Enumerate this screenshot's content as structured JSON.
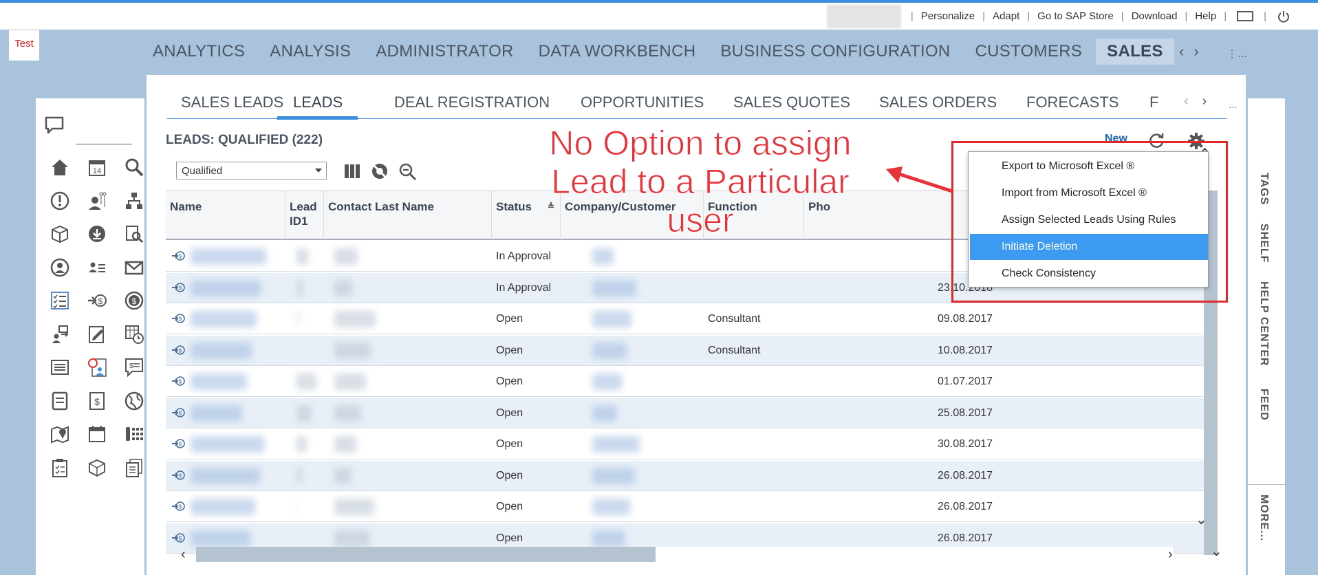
{
  "topbar": {
    "links": [
      "Personalize",
      "Adapt",
      "Go to SAP Store",
      "Download",
      "Help"
    ]
  },
  "badge": "Test",
  "main_nav": {
    "items": [
      "ANALYTICS",
      "ANALYSIS",
      "ADMINISTRATOR",
      "DATA WORKBENCH",
      "BUSINESS CONFIGURATION",
      "CUSTOMERS",
      "SALES"
    ],
    "active": "SALES"
  },
  "sub_nav": {
    "items": [
      "SALES LEADS",
      "LEADS",
      "DEAL REGISTRATION",
      "OPPORTUNITIES",
      "SALES QUOTES",
      "SALES ORDERS",
      "FORECASTS",
      "F"
    ],
    "active": "LEADS"
  },
  "list": {
    "title": "LEADS: QUALIFIED (222)",
    "new_label": "New",
    "view_value": "Qualified"
  },
  "table": {
    "columns": [
      "Name",
      "Lead ID1",
      "Contact Last Name",
      "Status",
      "Company/Customer",
      "Function",
      "Pho"
    ],
    "rows": [
      {
        "status": "In Approval",
        "function": "",
        "date": ""
      },
      {
        "status": "In Approval",
        "function": "",
        "date": "23.10.2018"
      },
      {
        "status": "Open",
        "function": "Consultant",
        "date": "09.08.2017"
      },
      {
        "status": "Open",
        "function": "Consultant",
        "date": "10.08.2017"
      },
      {
        "status": "Open",
        "function": "",
        "date": "01.07.2017"
      },
      {
        "status": "Open",
        "function": "",
        "date": "25.08.2017"
      },
      {
        "status": "Open",
        "function": "",
        "date": "30.08.2017"
      },
      {
        "status": "Open",
        "function": "",
        "date": "26.08.2017"
      },
      {
        "status": "Open",
        "function": "",
        "date": "26.08.2017"
      },
      {
        "status": "Open",
        "function": "",
        "date": "26.08.2017"
      }
    ]
  },
  "settings_menu": {
    "items": [
      "Export to Microsoft Excel ®",
      "Import from Microsoft Excel ®",
      "Assign Selected Leads Using Rules",
      "Initiate Deletion",
      "Check Consistency"
    ],
    "selected": "Initiate Deletion"
  },
  "right_tabs": [
    "TAGS",
    "SHELF",
    "HELP CENTER",
    "FEED",
    "MORE..."
  ],
  "annotation": {
    "lines": [
      "No Option to assign",
      "Lead to a Particular",
      "user"
    ],
    "color": "#e8333a"
  },
  "colors": {
    "accent": "#3c8ddb",
    "background": "#a9c3dc",
    "menu_selected": "#3c9bf0",
    "annotation_red": "#e02a2a"
  }
}
